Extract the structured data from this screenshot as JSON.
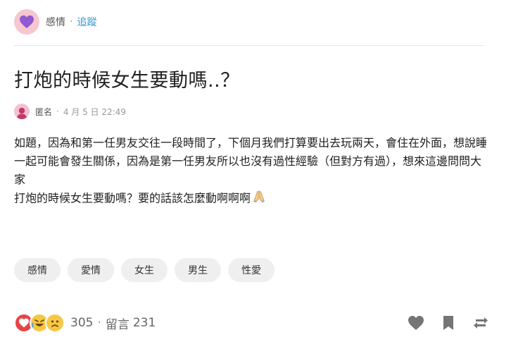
{
  "board": {
    "name": "感情",
    "separator": "·",
    "follow_label": "追蹤",
    "icon": "heart-board-icon",
    "icon_color": "#8e5bd1"
  },
  "post": {
    "title": "打炮的時候女生要動嗎..？",
    "author": "匿名",
    "separator": "·",
    "time": "4 月 5 日 22:49",
    "body_lines": [
      "如題，因為和第一任男友交往一段時間了，下個月我們打算要出去玩兩天，會住在外面，想說睡一起可能會發生關係，因為是第一任男友所以也沒有過性經驗（但對方有過），想來這邊問問大家",
      "打炮的時候女生要動嗎？要的話該怎麼動啊啊啊"
    ]
  },
  "tags": [
    "感情",
    "愛情",
    "女生",
    "男生",
    "性愛"
  ],
  "footer": {
    "reactions": [
      "heart-reaction-icon",
      "haha-reaction-icon",
      "sad-reaction-icon"
    ],
    "reaction_count": "305",
    "separator": "·",
    "comment_label": "留言",
    "comment_count": "231",
    "actions": [
      "like-icon",
      "bookmark-icon",
      "share-icon"
    ]
  },
  "colors": {
    "accent": "#3397cf",
    "heart": "#e64545",
    "emoji_yellow": "#f7c744",
    "icon_gray": "#757575"
  }
}
